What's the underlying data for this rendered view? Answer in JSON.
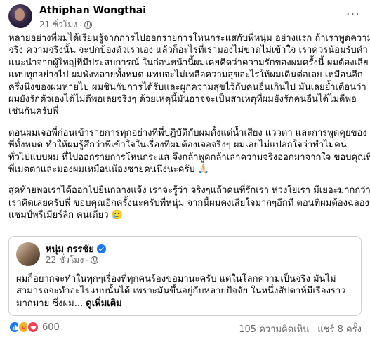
{
  "post": {
    "author": "Athiphan Wongthai",
    "time": "21 ชั่วโมง",
    "dot": "·",
    "more_glyph": "···",
    "paragraphs": [
      [
        "หลายอย่างที่ผมได้เรียนรู้จากการไปออกรายการโหนกระแสกับพี่หนุ่ม อย่างแรก ถ้าเราพูดความ",
        "จริง ความจริงนั้น จะปกป้องตัวเราเอง แล้วก็อะไรที่เรามองไม่ขาดไม่เข้าใจ เราควรน้อมรับคำ",
        "แนะนำจากผู้ใหญ่ที่มีประสบการณ์ ในก่อนหน้านี้ผมเคยคิดว่าความรักของผมครั้งนี้ ผมต้องเสีย",
        "แทบทุกอย่างไป ผมพังหลายทั้งหมด แทบจะไม่เหลือความสุขอะไรให้ผมเดินต่อเลย เหมือนอีก",
        "ครึ่งนึงของผมหายไป ผมชินกับการได้รับและผูกความสุขไว้กับคนอื่นเกินไป มันเลยย้ำเตือนว่า",
        "ผมยังรักตัวเองได้ไม่ดีพอเลยจริงๆ ด้วยเหตุนี้มันอาจจะเป็นสาเหตุที่ผมยังรักคนอื่นได้ไม่ดีพอ",
        "เช่นกันครับพี่"
      ],
      [
        "ตอนผมเจอพี่ก่อนเข้ารายการทุกอย่างที่พี่ปฏิบัติกับผมตั้งแต่น้ำเสียง แววตา และการพูดคุยของ",
        "พี่ทั้งหมด ทำให้ผมรู้สึกว่าพี่เข้าใจในเรื่องที่ผมต้องเจอจริงๆ ผมเลยไม่แปลกใจว่าทำไมคน",
        "ทั่วไปแบบผม ที่ไปออกรายการโหนกระแส จึงกล้าพูดกล้าเล่าความจริงออกมาจากใจ ขอบคุณที่",
        "พี่เมตตาและมองผมเหมือนน้องชายคนนึงนะครับ 🙏🏻"
      ],
      [
        "สุดท้ายพอเราได้ออกไปยืนกลางแจ้ง เราจะรู้ว่า จริงๆแล้วคนที่รักเรา ห่วงใยเรา มีเยอะมากกว่าที่",
        "เราคิดเลยครับพี่ ขอบคุณอีกครั้งนะครับพี่หนุ่ม จากนี้ผมคงเสียใจมากๆอีกที ตอนที่ผมต้องฉลอง",
        "แชมป์พรีเมียร์ลีก คนเดียว 🥲"
      ]
    ]
  },
  "shared": {
    "author": "หนุ่ม กรรชัย",
    "time": "22 ชั่วโมง",
    "dot": "·",
    "lines": [
      "ผมก็อยากจะทำในทุกๆเรื่องที่ทุกคนร้องขอมานะครับ แต่ในโลกความเป็นจริง มันไม่",
      "สามารถจะทำอะไรแบบนั้นได้ เพราะมันขึ้นอยู่กับหลายปัจจัย  ในหนึ่งสัปดาห์มีเรื่องราว"
    ],
    "last_line": "มากมาย ซึ่งผม...",
    "see_more": "ดูเพิ่มเติม"
  },
  "footer": {
    "reaction_count": "600",
    "comments": "105 ความคิดเห็น",
    "shares": "แชร์ 8 ครั้ง"
  },
  "icons": {
    "like": "like-icon",
    "care": "care-icon",
    "love": "love-icon",
    "globe": "globe-icon",
    "verified": "verified-badge-icon"
  },
  "colors": {
    "accent": "#1877f2",
    "secondary_text": "#65676b",
    "love": "#f33e58",
    "care": "#f7b125"
  }
}
